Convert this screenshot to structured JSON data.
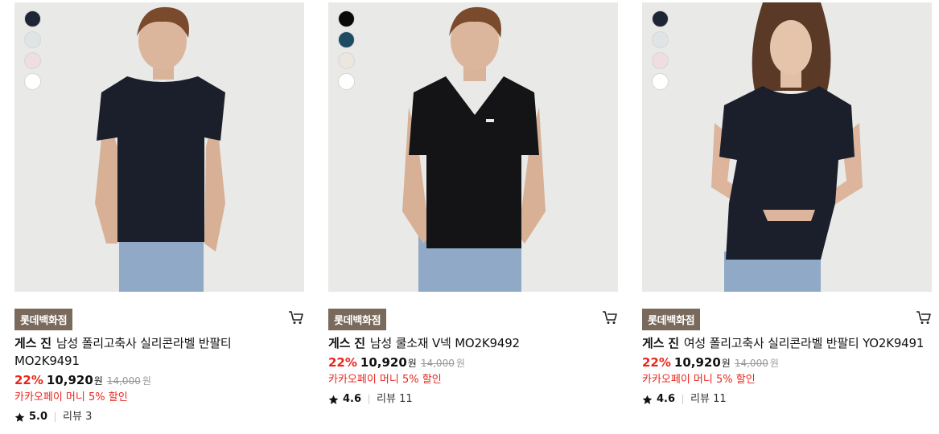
{
  "products": [
    {
      "swatches": [
        "#1e2535",
        "#dfe5e6",
        "#f0dde1",
        "#ffffff"
      ],
      "store_badge": "롯데백화점",
      "brand": "게스 진",
      "name": "남성 폴리고축사 실리콘라벨 반팔티",
      "name_line2": "MO2K9491",
      "discount_rate": "22%",
      "sale_price": "10,920",
      "sale_unit": "원",
      "original_price": "14,000",
      "original_unit": "원",
      "promo": "카카오페이 머니 5% 할인",
      "rating": "5.0",
      "review_label": "리뷰 3",
      "shirt_color": "#1b1f2b"
    },
    {
      "swatches": [
        "#0a0a0a",
        "#1f4a63",
        "#ece7de",
        "#ffffff"
      ],
      "store_badge": "롯데백화점",
      "brand": "게스 진",
      "name": "남성 쿨소재 V넥 MO2K9492",
      "name_line2": "",
      "discount_rate": "22%",
      "sale_price": "10,920",
      "sale_unit": "원",
      "original_price": "14,000",
      "original_unit": "원",
      "promo": "카카오페이 머니 5% 할인",
      "rating": "4.6",
      "review_label": "리뷰 11",
      "shirt_color": "#141416"
    },
    {
      "swatches": [
        "#1e2535",
        "#dfe5e6",
        "#f0dde1",
        "#ffffff"
      ],
      "store_badge": "롯데백화점",
      "brand": "게스 진",
      "name": "여성 폴리고축사 실리콘라벨 반팔티 YO2K9491",
      "name_line2": "",
      "discount_rate": "22%",
      "sale_price": "10,920",
      "sale_unit": "원",
      "original_price": "14,000",
      "original_unit": "원",
      "promo": "카카오페이 머니 5% 할인",
      "rating": "4.6",
      "review_label": "리뷰 11",
      "shirt_color": "#1b1f2b"
    }
  ]
}
